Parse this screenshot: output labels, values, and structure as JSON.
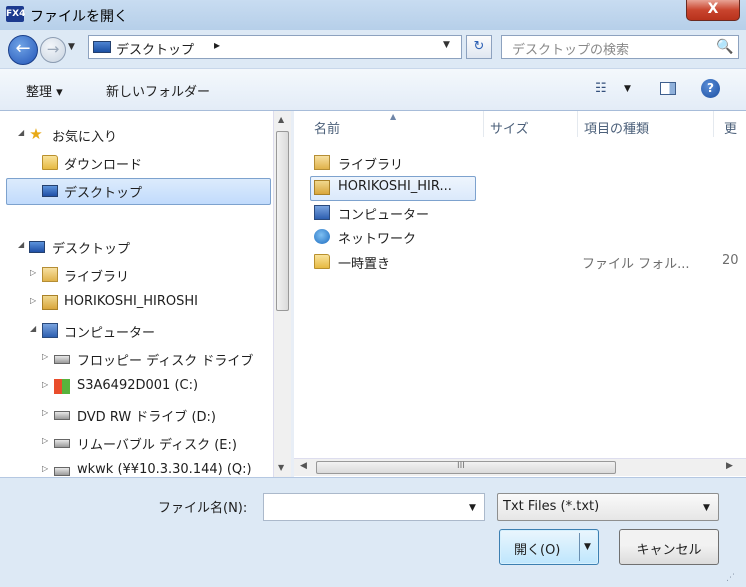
{
  "window": {
    "app_icon_text": "FX4",
    "title": "ファイルを開く",
    "close_symbol": "X"
  },
  "nav": {
    "back_symbol": "←",
    "forward_symbol": "→",
    "address": "デスクトップ",
    "address_separator": "▸",
    "refresh_symbol": "↻",
    "search_placeholder": "デスクトップの検索",
    "search_icon": "🔍"
  },
  "toolbar": {
    "organize": "整理 ▾",
    "new_folder": "新しいフォルダー",
    "view_icon": "☷"
  },
  "navpane": {
    "items": [
      {
        "label": "お気に入り",
        "icon": "star-icon"
      },
      {
        "label": "ダウンロード",
        "icon": "downloads-folder-icon"
      },
      {
        "label": "デスクトップ",
        "icon": "desktop-icon"
      },
      {
        "label": "デスクトップ",
        "icon": "desktop-icon"
      },
      {
        "label": "ライブラリ",
        "icon": "library-icon"
      },
      {
        "label": "HORIKOSHI_HIROSHI",
        "icon": "user-folder-icon"
      },
      {
        "label": "コンピューター",
        "icon": "computer-icon"
      },
      {
        "label": "フロッピー ディスク ドライブ",
        "icon": "floppy-drive-icon"
      },
      {
        "label": "S3A6492D001 (C:)",
        "icon": "windows-drive-icon"
      },
      {
        "label": "DVD RW ドライブ (D:)",
        "icon": "dvd-drive-icon"
      },
      {
        "label": "リムーバブル ディスク (E:)",
        "icon": "removable-drive-icon"
      },
      {
        "label": "wkwk (¥¥10.3.30.144) (Q:)",
        "icon": "network-drive-icon"
      }
    ]
  },
  "content": {
    "columns": [
      "名前",
      "サイズ",
      "項目の種類",
      "更"
    ],
    "files": [
      {
        "name": "ライブラリ",
        "icon": "library-icon",
        "type": "",
        "date": ""
      },
      {
        "name": "HORIKOSHI_HIR...",
        "icon": "user-folder-icon",
        "type": "",
        "date": ""
      },
      {
        "name": "コンピューター",
        "icon": "computer-icon",
        "type": "",
        "date": ""
      },
      {
        "name": "ネットワーク",
        "icon": "network-icon",
        "type": "",
        "date": ""
      },
      {
        "name": "一時置き",
        "icon": "folder-icon",
        "type": "ファイル フォル...",
        "date": "20"
      }
    ],
    "hscroll_grip": "III"
  },
  "bottom": {
    "filename_label": "ファイル名(N):",
    "filename_value": "",
    "filetype_selected": "Txt Files (*.txt)",
    "open_label": "開く(O)",
    "cancel_label": "キャンセル"
  }
}
